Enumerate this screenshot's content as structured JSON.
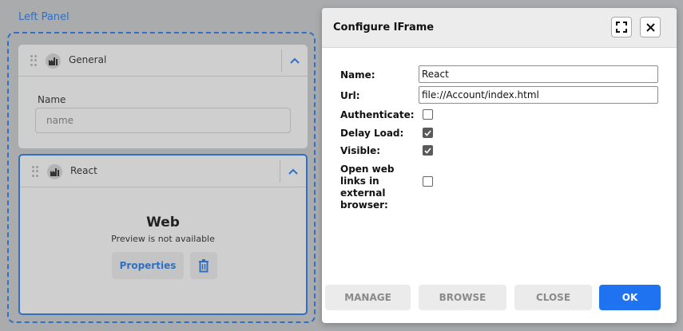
{
  "left_panel": {
    "title": "Left Panel",
    "general_card": {
      "title": "General",
      "field_label": "Name",
      "field_placeholder": "name"
    },
    "react_card": {
      "title": "React",
      "preview_title": "Web",
      "preview_subtitle": "Preview is not available",
      "properties_label": "Properties"
    }
  },
  "dialog": {
    "title": "Configure IFrame",
    "fields": {
      "name_label": "Name:",
      "name_value": "React",
      "url_label": "Url:",
      "url_value": "file://Account/index.html",
      "authenticate_label": "Authenticate:",
      "authenticate_checked": false,
      "delay_load_label": "Delay Load:",
      "delay_load_checked": true,
      "visible_label": "Visible:",
      "visible_checked": true,
      "open_links_label": "Open web links in external browser:",
      "open_links_checked": false
    },
    "footer": {
      "manage_label": "MANAGE",
      "browse_label": "BROWSE",
      "close_label": "CLOSE",
      "ok_label": "OK"
    }
  },
  "colors": {
    "accent": "#2f6fc4",
    "primary_button": "#1f73f0",
    "overlay": "#a9abad"
  }
}
